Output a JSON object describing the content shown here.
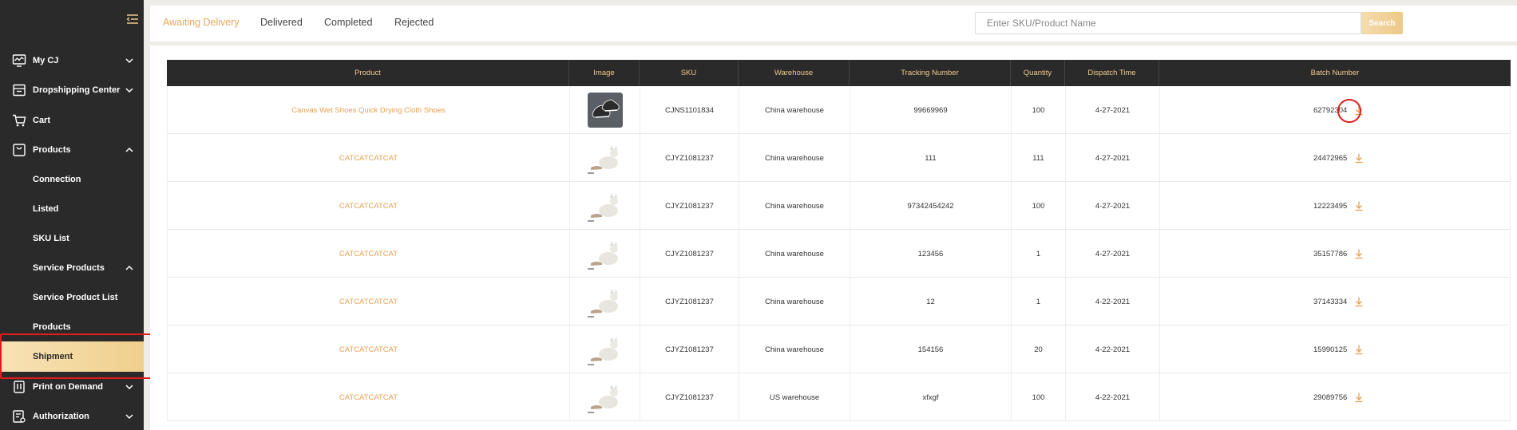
{
  "sidebar": {
    "items": [
      {
        "label": "My CJ",
        "icon": "monitor-icon",
        "chevron": "down"
      },
      {
        "label": "Dropshipping Center",
        "icon": "package-icon",
        "chevron": "down"
      },
      {
        "label": "Cart",
        "icon": "cart-icon",
        "chevron": ""
      },
      {
        "label": "Products",
        "icon": "bag-icon",
        "chevron": "up"
      }
    ],
    "sub_items": [
      "Connection",
      "Listed",
      "SKU List"
    ],
    "service_products": {
      "label": "Service Products",
      "chevron": "up"
    },
    "service_sub": [
      "Service Product List",
      "Products"
    ],
    "active": {
      "label": "Shipment"
    },
    "bottom_items": [
      {
        "label": "Print on Demand",
        "icon": "print-icon",
        "chevron": "down"
      },
      {
        "label": "Authorization",
        "icon": "authorization-icon",
        "chevron": "down"
      }
    ]
  },
  "tabs": [
    "Awaiting Delivery",
    "Delivered",
    "Completed",
    "Rejected"
  ],
  "search": {
    "placeholder": "Enter SKU/Product Name",
    "button": "Search"
  },
  "table": {
    "headers": [
      "Product",
      "Image",
      "SKU",
      "Warehouse",
      "Tracking Number",
      "Quantity",
      "Dispatch Time",
      "Batch Number"
    ],
    "rows": [
      {
        "product": "Canvas Wet Shoes Quick Drying Cloth Shoes",
        "image": "shoes",
        "sku": "CJNS1101834",
        "warehouse": "China warehouse",
        "tracking": "99669969",
        "quantity": "100",
        "dispatch": "4-27-2021",
        "batch": "62792304"
      },
      {
        "product": "CATCATCATCAT",
        "image": "cat",
        "sku": "CJYZ1081237",
        "warehouse": "China warehouse",
        "tracking": "111",
        "quantity": "111",
        "dispatch": "4-27-2021",
        "batch": "24472965"
      },
      {
        "product": "CATCATCATCAT",
        "image": "cat",
        "sku": "CJYZ1081237",
        "warehouse": "China warehouse",
        "tracking": "97342454242",
        "quantity": "100",
        "dispatch": "4-27-2021",
        "batch": "12223495"
      },
      {
        "product": "CATCATCATCAT",
        "image": "cat",
        "sku": "CJYZ1081237",
        "warehouse": "China warehouse",
        "tracking": "123456",
        "quantity": "1",
        "dispatch": "4-27-2021",
        "batch": "35157786"
      },
      {
        "product": "CATCATCATCAT",
        "image": "cat",
        "sku": "CJYZ1081237",
        "warehouse": "China warehouse",
        "tracking": "12",
        "quantity": "1",
        "dispatch": "4-22-2021",
        "batch": "37143334"
      },
      {
        "product": "CATCATCATCAT",
        "image": "cat",
        "sku": "CJYZ1081237",
        "warehouse": "China warehouse",
        "tracking": "154156",
        "quantity": "20",
        "dispatch": "4-22-2021",
        "batch": "15990125"
      },
      {
        "product": "CATCATCATCAT",
        "image": "cat",
        "sku": "CJYZ1081237",
        "warehouse": "US warehouse",
        "tracking": "xfxgf",
        "quantity": "100",
        "dispatch": "4-22-2021",
        "batch": "29089756"
      }
    ]
  },
  "colors": {
    "accent": "#e8a85a",
    "sidebar_bg": "#2a2a2a",
    "highlight": "#e31b1b"
  }
}
